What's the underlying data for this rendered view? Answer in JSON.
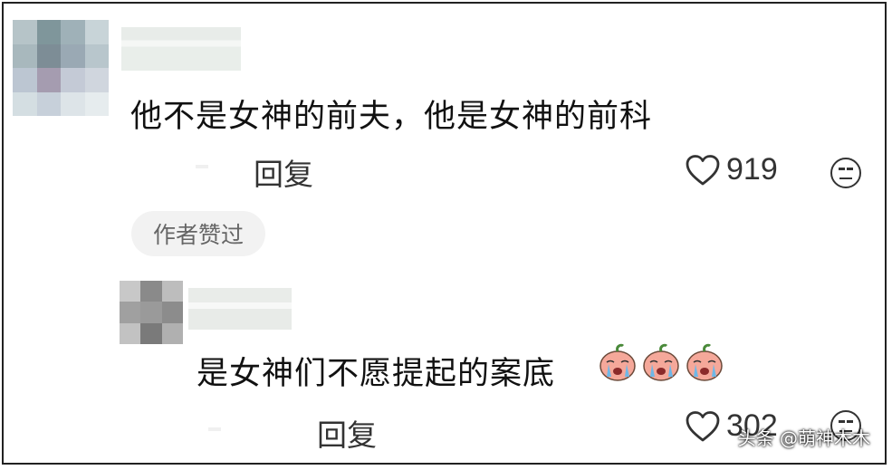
{
  "comments": [
    {
      "text": "他不是女神的前夫，他是女神的前科",
      "reply_label": "回复",
      "likes": "919",
      "author_badge": "作者赞过",
      "avatar_colors": [
        "#b6c4c8",
        "#7f969b",
        "#9fb1b8",
        "#c8d4d8",
        "#a8b8bd",
        "#7d8d96",
        "#9aa9b4",
        "#b8c6cc",
        "#bcc6d2",
        "#a59cb0",
        "#c4cad6",
        "#d0d6de",
        "#d4dee2",
        "#c7d0da",
        "#dde4e8",
        "#e6ecee"
      ]
    },
    {
      "text": "是女神们不愿提起的案底",
      "reply_label": "回复",
      "likes": "302",
      "emoji_icons": [
        "crying-peach-emoji",
        "crying-peach-emoji",
        "crying-peach-emoji"
      ],
      "avatar_colors": [
        "#c8c8c8",
        "#8a8a8a",
        "#bdbdbd",
        "#a0a0a0",
        "#9a9a9a",
        "#8c8c8c",
        "#c2c2c2",
        "#7a7a7a",
        "#b0b0b0"
      ]
    }
  ],
  "watermark": "头条 @萌神木木"
}
